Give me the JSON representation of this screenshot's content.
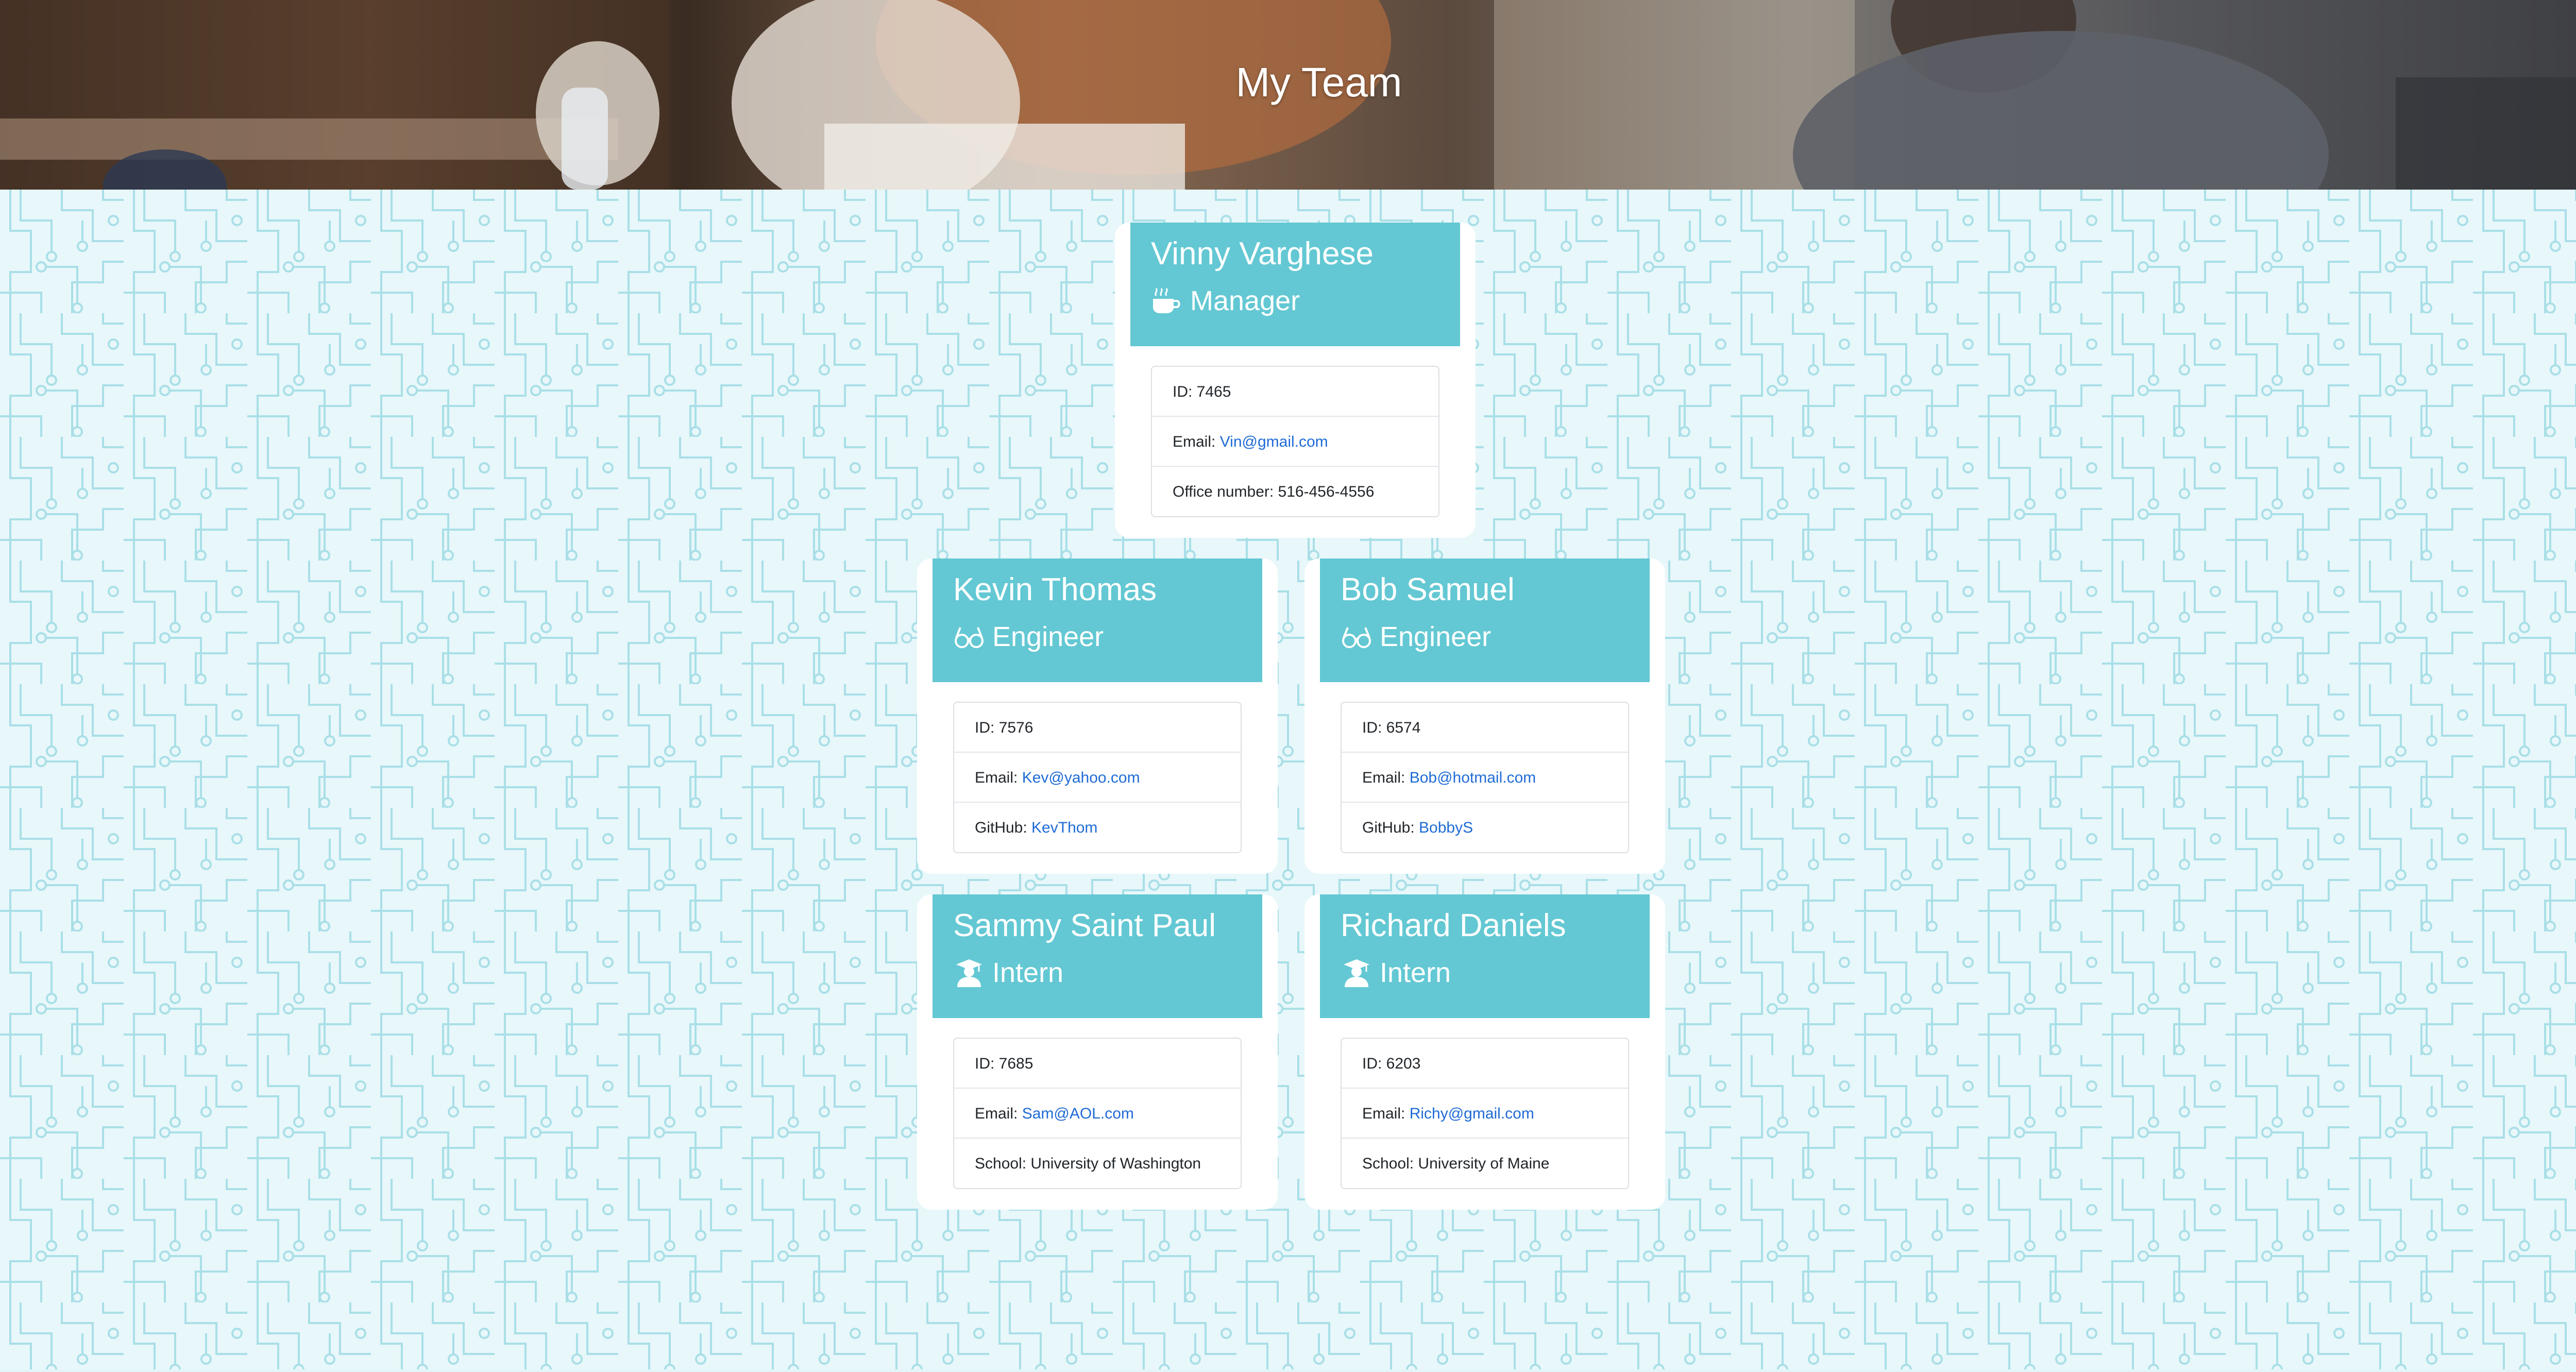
{
  "header": {
    "title": "My Team"
  },
  "colors": {
    "card_header": "#63c8d3",
    "link": "#1f6bd6",
    "pattern_line": "#a9dfe7"
  },
  "labels": {
    "id": "ID: ",
    "email": "Email: ",
    "office": "Office number: ",
    "github": "GitHub: ",
    "school": "School: "
  },
  "employees": [
    {
      "name": "Vinny Varghese",
      "role": "Manager",
      "icon": "coffee-icon",
      "id": "7465",
      "email": "Vin@gmail.com",
      "office": "516-456-4556"
    },
    {
      "name": "Kevin Thomas",
      "role": "Engineer",
      "icon": "glasses-icon",
      "id": "7576",
      "email": "Kev@yahoo.com",
      "github": "KevThom"
    },
    {
      "name": "Bob Samuel",
      "role": "Engineer",
      "icon": "glasses-icon",
      "id": "6574",
      "email": "Bob@hotmail.com",
      "github": "BobbyS"
    },
    {
      "name": "Sammy Saint Paul",
      "role": "Intern",
      "icon": "graduate-icon",
      "id": "7685",
      "email": "Sam@AOL.com",
      "school": "University of Washington"
    },
    {
      "name": "Richard Daniels",
      "role": "Intern",
      "icon": "graduate-icon",
      "id": "6203",
      "email": "Richy@gmail.com",
      "school": "University of Maine"
    }
  ]
}
